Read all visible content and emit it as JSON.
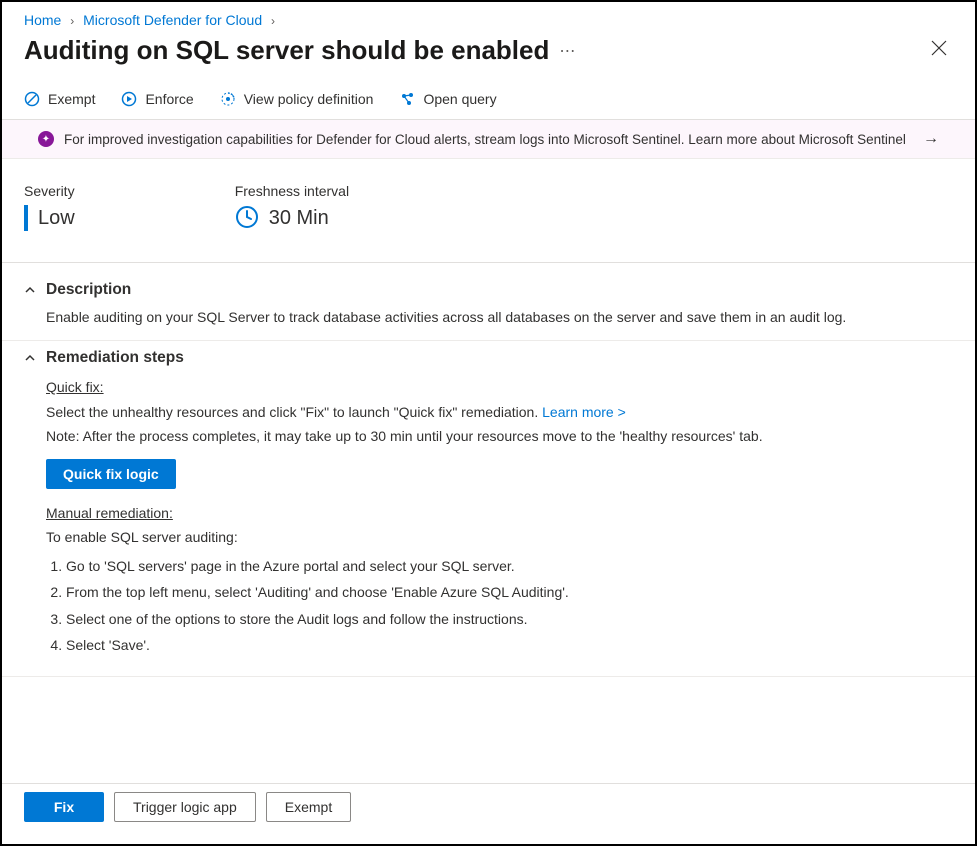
{
  "breadcrumb": {
    "home": "Home",
    "defender": "Microsoft Defender for Cloud"
  },
  "title": "Auditing on SQL server should be enabled",
  "toolbar": {
    "exempt": "Exempt",
    "enforce": "Enforce",
    "view_policy": "View policy definition",
    "open_query": "Open query"
  },
  "banner": {
    "text": "For improved investigation capabilities for Defender for Cloud alerts, stream logs into Microsoft Sentinel. Learn more about Microsoft Sentinel"
  },
  "meta": {
    "severity_label": "Severity",
    "severity_value": "Low",
    "freshness_label": "Freshness interval",
    "freshness_value": "30 Min"
  },
  "description": {
    "heading": "Description",
    "text": "Enable auditing on your SQL Server to track database activities across all databases on the server and save them in an audit log."
  },
  "remediation": {
    "heading": "Remediation steps",
    "quick_fix_label": "Quick fix:",
    "quick_fix_text_pre": "Select the unhealthy resources and click \"Fix\" to launch \"Quick fix\" remediation. ",
    "learn_more": "Learn more >",
    "quick_fix_note": "Note: After the process completes, it may take up to 30 min until your resources move to the 'healthy resources' tab.",
    "quick_fix_logic_btn": "Quick fix logic",
    "manual_label": "Manual remediation:",
    "manual_intro": "To enable SQL server auditing:",
    "steps": [
      "Go to 'SQL servers' page in the Azure portal and select your SQL server.",
      "From the top left menu, select 'Auditing' and choose 'Enable Azure SQL Auditing'.",
      "Select one of the options to store the Audit logs and follow the instructions.",
      "Select 'Save'."
    ]
  },
  "footer": {
    "fix": "Fix",
    "trigger": "Trigger logic app",
    "exempt": "Exempt"
  }
}
